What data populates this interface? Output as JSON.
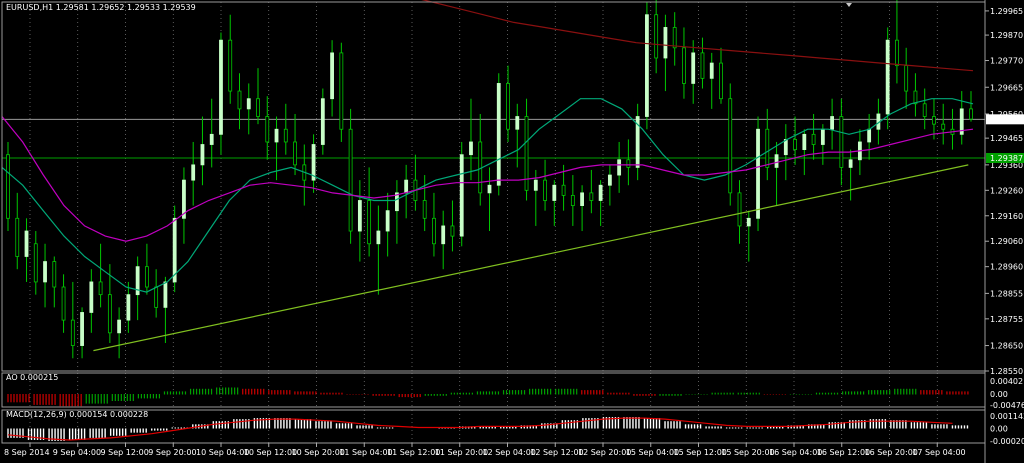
{
  "header": {
    "main": "EURUSD,H1  1.29581 1.29652 1.29533 1.29539",
    "ao": "AO 0.000215",
    "macd": "MACD(12,26,9) 0.000154 0.000228"
  },
  "price_axis": {
    "ticks": [
      "1.29965",
      "1.29870",
      "1.29770",
      "1.29665",
      "1.29560",
      "1.29465",
      "1.29360",
      "1.29260",
      "1.29160",
      "1.29060",
      "1.28960",
      "1.28855",
      "1.28755",
      "1.28650",
      "1.28550"
    ],
    "current_price": "1.29539",
    "hline_price": "1.29387"
  },
  "ao_axis": {
    "ticks": [
      "0.00402",
      "0.00",
      "-0.00476"
    ]
  },
  "macd_axis": {
    "ticks": [
      "0.001142",
      "0.00",
      "-0.000201"
    ]
  },
  "time_axis": {
    "labels": [
      "8 Sep 2014",
      "9 Sep 04:00",
      "9 Sep 12:00",
      "9 Sep 20:00",
      "10 Sep 04:00",
      "10 Sep 12:00",
      "10 Sep 20:00",
      "11 Sep 04:00",
      "11 Sep 12:00",
      "11 Sep 20:00",
      "12 Sep 04:00",
      "12 Sep 12:00",
      "12 Sep 20:00",
      "15 Sep 04:00",
      "15 Sep 12:00",
      "15 Sep 20:00",
      "16 Sep 04:00",
      "16 Sep 12:00",
      "16 Sep 20:00",
      "17 Sep 04:00"
    ]
  },
  "colors": {
    "background": "#000000",
    "bull": "#c8ffc8",
    "bear": "#00c800",
    "wick": "#00c800",
    "ma_fast": "#00a878",
    "ma_mid": "#c000c0",
    "ma_slow": "#8a1010",
    "trendline": "#80c020",
    "hline": "#00a000",
    "grid": "#808080",
    "ao_up": "#00a000",
    "ao_down": "#d00000",
    "macd_hist": "#ffffff",
    "macd_signal": "#e00000"
  },
  "chart_data": {
    "type": "candlestick",
    "symbol": "EURUSD",
    "timeframe": "H1",
    "ylim": [
      1.2855,
      1.3
    ],
    "candles": [
      [
        1.294,
        1.2945,
        1.291,
        1.2915
      ],
      [
        1.2915,
        1.2925,
        1.2895,
        1.29
      ],
      [
        1.29,
        1.2915,
        1.289,
        1.291
      ],
      [
        1.2905,
        1.291,
        1.2885,
        1.289
      ],
      [
        1.289,
        1.2905,
        1.288,
        1.2898
      ],
      [
        1.2898,
        1.29,
        1.288,
        1.2888
      ],
      [
        1.2888,
        1.2893,
        1.287,
        1.2875
      ],
      [
        1.2875,
        1.289,
        1.286,
        1.2865
      ],
      [
        1.2865,
        1.288,
        1.286,
        1.2878
      ],
      [
        1.2878,
        1.2895,
        1.287,
        1.289
      ],
      [
        1.289,
        1.2905,
        1.288,
        1.2885
      ],
      [
        1.2885,
        1.2897,
        1.2866,
        1.287
      ],
      [
        1.287,
        1.288,
        1.286,
        1.2875
      ],
      [
        1.2875,
        1.289,
        1.287,
        1.2885
      ],
      [
        1.2885,
        1.29,
        1.2875,
        1.2896
      ],
      [
        1.2896,
        1.2905,
        1.2885,
        1.2888
      ],
      [
        1.2888,
        1.2895,
        1.2876,
        1.288
      ],
      [
        1.288,
        1.2892,
        1.2866,
        1.289
      ],
      [
        1.289,
        1.292,
        1.2886,
        1.2915
      ],
      [
        1.2915,
        1.2935,
        1.2905,
        1.293
      ],
      [
        1.293,
        1.2945,
        1.292,
        1.2936
      ],
      [
        1.2936,
        1.2955,
        1.2928,
        1.2944
      ],
      [
        1.2944,
        1.2962,
        1.2935,
        1.2948
      ],
      [
        1.2948,
        1.2988,
        1.294,
        1.2985
      ],
      [
        1.2985,
        1.2995,
        1.296,
        1.2965
      ],
      [
        1.2965,
        1.2972,
        1.295,
        1.2958
      ],
      [
        1.2958,
        1.2968,
        1.2948,
        1.2962
      ],
      [
        1.2962,
        1.2974,
        1.2952,
        1.2955
      ],
      [
        1.2955,
        1.2963,
        1.2938,
        1.2945
      ],
      [
        1.2945,
        1.2955,
        1.293,
        1.295
      ],
      [
        1.295,
        1.296,
        1.294,
        1.2945
      ],
      [
        1.2945,
        1.2956,
        1.2932,
        1.2936
      ],
      [
        1.2936,
        1.2944,
        1.292,
        1.293
      ],
      [
        1.293,
        1.2948,
        1.2925,
        1.2944
      ],
      [
        1.2944,
        1.2966,
        1.294,
        1.2962
      ],
      [
        1.2962,
        1.2985,
        1.2955,
        1.298
      ],
      [
        1.298,
        1.2984,
        1.2945,
        1.295
      ],
      [
        1.295,
        1.2958,
        1.2905,
        1.291
      ],
      [
        1.291,
        1.293,
        1.2898,
        1.2922
      ],
      [
        1.2922,
        1.2935,
        1.29,
        1.2905
      ],
      [
        1.2905,
        1.292,
        1.2885,
        1.291
      ],
      [
        1.291,
        1.2925,
        1.29,
        1.2918
      ],
      [
        1.2918,
        1.293,
        1.2905,
        1.2925
      ],
      [
        1.2925,
        1.2936,
        1.2915,
        1.293
      ],
      [
        1.293,
        1.294,
        1.2918,
        1.2922
      ],
      [
        1.2922,
        1.2932,
        1.291,
        1.2915
      ],
      [
        1.2915,
        1.2925,
        1.29,
        1.2905
      ],
      [
        1.2905,
        1.2918,
        1.2895,
        1.2912
      ],
      [
        1.2912,
        1.2922,
        1.2902,
        1.2908
      ],
      [
        1.2908,
        1.2945,
        1.2904,
        1.294
      ],
      [
        1.294,
        1.2962,
        1.293,
        1.2945
      ],
      [
        1.2945,
        1.2956,
        1.292,
        1.2925
      ],
      [
        1.2925,
        1.2935,
        1.291,
        1.2928
      ],
      [
        1.2928,
        1.2972,
        1.2924,
        1.2968
      ],
      [
        1.2968,
        1.2975,
        1.2945,
        1.295
      ],
      [
        1.295,
        1.296,
        1.2935,
        1.2955
      ],
      [
        1.2955,
        1.2962,
        1.2922,
        1.2926
      ],
      [
        1.2926,
        1.2934,
        1.2912,
        1.293
      ],
      [
        1.293,
        1.2938,
        1.2918,
        1.2922
      ],
      [
        1.2922,
        1.293,
        1.2912,
        1.2928
      ],
      [
        1.2928,
        1.2936,
        1.2918,
        1.2924
      ],
      [
        1.2924,
        1.2932,
        1.2912,
        1.292
      ],
      [
        1.292,
        1.2928,
        1.291,
        1.2925
      ],
      [
        1.2925,
        1.2934,
        1.2917,
        1.2922
      ],
      [
        1.2922,
        1.293,
        1.2912,
        1.2928
      ],
      [
        1.2928,
        1.2936,
        1.292,
        1.2932
      ],
      [
        1.2932,
        1.2945,
        1.2925,
        1.2938
      ],
      [
        1.2938,
        1.2946,
        1.2928,
        1.2935
      ],
      [
        1.2935,
        1.296,
        1.293,
        1.2955
      ],
      [
        1.2955,
        1.3,
        1.295,
        1.2995
      ],
      [
        1.2995,
        1.3002,
        1.2972,
        1.2978
      ],
      [
        1.2978,
        1.2995,
        1.2965,
        1.299
      ],
      [
        1.299,
        1.2996,
        1.2975,
        1.2982
      ],
      [
        1.2982,
        1.299,
        1.2962,
        1.2968
      ],
      [
        1.2968,
        1.2985,
        1.296,
        1.298
      ],
      [
        1.298,
        1.2986,
        1.2966,
        1.297
      ],
      [
        1.297,
        1.298,
        1.2958,
        1.2976
      ],
      [
        1.2976,
        1.2982,
        1.296,
        1.2962
      ],
      [
        1.2962,
        1.2968,
        1.292,
        1.2925
      ],
      [
        1.2925,
        1.293,
        1.2905,
        1.2912
      ],
      [
        1.2912,
        1.2918,
        1.2898,
        1.2915
      ],
      [
        1.2915,
        1.2955,
        1.291,
        1.295
      ],
      [
        1.295,
        1.2958,
        1.293,
        1.2935
      ],
      [
        1.2935,
        1.2945,
        1.292,
        1.294
      ],
      [
        1.294,
        1.2952,
        1.293,
        1.2946
      ],
      [
        1.2946,
        1.2955,
        1.2936,
        1.2942
      ],
      [
        1.2942,
        1.295,
        1.2932,
        1.2948
      ],
      [
        1.2948,
        1.2956,
        1.2938,
        1.2944
      ],
      [
        1.2944,
        1.2952,
        1.2936,
        1.295
      ],
      [
        1.295,
        1.2962,
        1.2942,
        1.2955
      ],
      [
        1.2955,
        1.2962,
        1.2928,
        1.2935
      ],
      [
        1.2935,
        1.2942,
        1.2922,
        1.2938
      ],
      [
        1.2938,
        1.295,
        1.2932,
        1.2945
      ],
      [
        1.2945,
        1.2956,
        1.2938,
        1.295
      ],
      [
        1.295,
        1.2962,
        1.2944,
        1.2956
      ],
      [
        1.2956,
        1.299,
        1.295,
        1.2985
      ],
      [
        1.2985,
        1.3003,
        1.2968,
        1.2975
      ],
      [
        1.2975,
        1.2982,
        1.2958,
        1.2965
      ],
      [
        1.2965,
        1.2972,
        1.2955,
        1.296
      ],
      [
        1.296,
        1.2966,
        1.295,
        1.2955
      ],
      [
        1.2955,
        1.2962,
        1.2946,
        1.2952
      ],
      [
        1.2952,
        1.296,
        1.2944,
        1.295
      ],
      [
        1.295,
        1.2958,
        1.2942,
        1.2948
      ],
      [
        1.2948,
        1.2965,
        1.2944,
        1.2958
      ],
      [
        1.2958,
        1.2965,
        1.2953,
        1.2954
      ]
    ],
    "series": [
      {
        "role": "ma_fast",
        "values": [
          1.2935,
          1.2928,
          1.2918,
          1.2908,
          1.29,
          1.2894,
          1.2888,
          1.2886,
          1.289,
          1.2898,
          1.291,
          1.2922,
          1.293,
          1.2933,
          1.2935,
          1.2932,
          1.2928,
          1.2924,
          1.2922,
          1.2922,
          1.2926,
          1.293,
          1.2932,
          1.2934,
          1.2938,
          1.2942,
          1.295,
          1.2956,
          1.2962,
          1.2962,
          1.2958,
          1.295,
          1.294,
          1.2932,
          1.293,
          1.2932,
          1.2936,
          1.2941,
          1.2946,
          1.295,
          1.295,
          1.2948,
          1.295,
          1.2956,
          1.296,
          1.2962,
          1.2962,
          1.296
        ]
      },
      {
        "role": "ma_mid",
        "values": [
          1.2955,
          1.2945,
          1.2932,
          1.292,
          1.2912,
          1.2908,
          1.2906,
          1.2908,
          1.2912,
          1.2918,
          1.2922,
          1.2925,
          1.2928,
          1.2929,
          1.2928,
          1.2927,
          1.2925,
          1.2924,
          1.2923,
          1.2924,
          1.2926,
          1.2928,
          1.2929,
          1.2929,
          1.293,
          1.293,
          1.2931,
          1.2933,
          1.2935,
          1.2936,
          1.2936,
          1.2936,
          1.2934,
          1.2932,
          1.2932,
          1.2933,
          1.2934,
          1.2936,
          1.2938,
          1.294,
          1.2941,
          1.2941,
          1.2942,
          1.2944,
          1.2946,
          1.2948,
          1.2949,
          1.295
        ]
      },
      {
        "role": "ma_slow",
        "values": [
          1.301,
          1.3008,
          1.3004,
          1.3001,
          1.2998,
          1.2995,
          1.2992,
          1.299,
          1.2988,
          1.2986,
          1.2984,
          1.2983,
          1.2982,
          1.2981,
          1.298,
          1.2979,
          1.2978,
          1.2977,
          1.2976,
          1.2975,
          1.2974,
          1.2973
        ]
      }
    ],
    "trendline": {
      "x_start": 0.093,
      "y_start": 1.2863,
      "x_end": 0.983,
      "y_end": 1.2936
    },
    "indicators": {
      "ao": {
        "values": [
          -0.0006,
          -0.0008,
          -0.0009,
          -0.0007,
          -0.0005,
          -0.0003,
          0.0002,
          0.0004,
          0.0005,
          0.0004,
          0.0003,
          0.0002,
          0.0001,
          0.0,
          -0.0001,
          -0.0002,
          -0.0001,
          0.0001,
          0.0002,
          0.0003,
          0.0004,
          0.0004,
          0.0003,
          0.0001,
          -0.0001,
          -0.0001,
          0.0,
          0.0001,
          0.0001,
          0.0,
          0.0,
          0.0001,
          0.0002,
          0.0003,
          0.0004,
          0.0003,
          0.0002
        ]
      },
      "macd": {
        "hist": [
          -0.0009,
          -0.0011,
          -0.0012,
          -0.0011,
          -0.0009,
          -0.0007,
          -0.0004,
          -0.0002,
          0.0001,
          0.0004,
          0.0007,
          0.0009,
          0.001,
          0.001,
          0.0009,
          0.0007,
          0.0005,
          0.0003,
          0.0001,
          0.0,
          0.0,
          0.0001,
          0.0002,
          0.0002,
          0.0002,
          0.0003,
          0.0005,
          0.0008,
          0.001,
          0.0011,
          0.0011,
          0.001,
          0.0007,
          0.0004,
          0.0002,
          0.0001,
          0.0001,
          0.0002,
          0.0003,
          0.0004,
          0.0006,
          0.0008,
          0.0009,
          0.0008,
          0.0006,
          0.0004,
          0.0003
        ],
        "signal": [
          -0.0006,
          -0.0008,
          -0.001,
          -0.0011,
          -0.001,
          -0.0009,
          -0.0007,
          -0.0005,
          -0.0002,
          0.0001,
          0.0004,
          0.0006,
          0.0008,
          0.0009,
          0.0009,
          0.0008,
          0.0007,
          0.0005,
          0.0003,
          0.0002,
          0.0001,
          0.0001,
          0.0001,
          0.0002,
          0.0002,
          0.0002,
          0.0003,
          0.0005,
          0.0007,
          0.0009,
          0.001,
          0.001,
          0.0009,
          0.0007,
          0.0005,
          0.0003,
          0.0002,
          0.0002,
          0.0002,
          0.0003,
          0.0004,
          0.0006,
          0.0007,
          0.0007,
          0.0007,
          0.0006,
          0.0005
        ]
      }
    }
  }
}
